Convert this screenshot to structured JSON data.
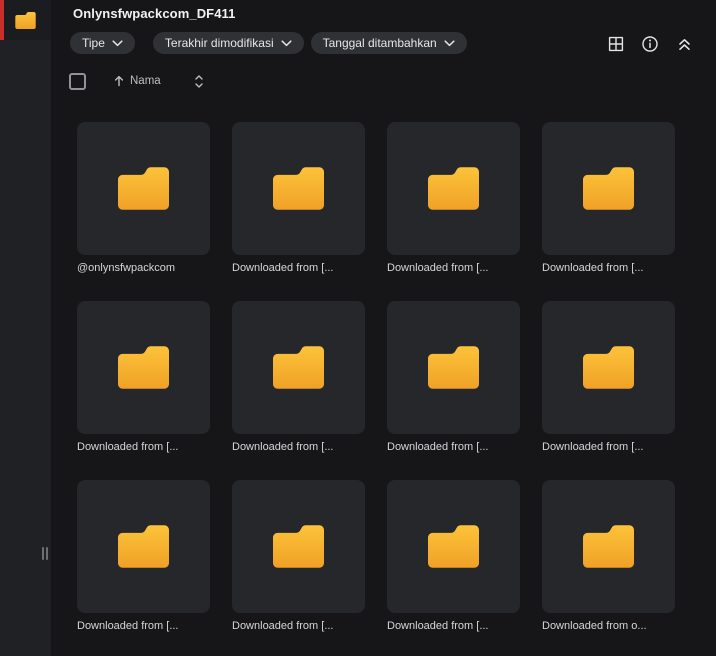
{
  "window": {
    "title": "Onlynsfwpackcom_DF411"
  },
  "colors": {
    "accent_red": "#cb2d2a",
    "folder_top": "#fcc33a",
    "folder_bottom": "#f0a127",
    "sidebar_bg": "#202124",
    "main_bg": "#161618",
    "tile_bg": "#25272a",
    "chip_bg": "#303134"
  },
  "sidebar": {
    "active_item_icon": "folder-icon"
  },
  "filters": {
    "chips": [
      {
        "label": "Tipe"
      },
      {
        "label": "Terakhir dimodifikasi"
      },
      {
        "label": "Tanggal ditambahkan"
      }
    ]
  },
  "header_actions": {
    "grid_view": "grid-view-icon",
    "info": "info-icon",
    "collapse": "double-chevron-up-icon"
  },
  "list_controls": {
    "sort_arrow": "↑",
    "sort_label": "Nama"
  },
  "folders": [
    {
      "name": "@onlynsfwpackcom"
    },
    {
      "name": "Downloaded from [..."
    },
    {
      "name": "Downloaded from [..."
    },
    {
      "name": "Downloaded from [..."
    },
    {
      "name": "Downloaded from [..."
    },
    {
      "name": "Downloaded from [..."
    },
    {
      "name": "Downloaded from [..."
    },
    {
      "name": "Downloaded from [..."
    },
    {
      "name": "Downloaded from [..."
    },
    {
      "name": "Downloaded from [..."
    },
    {
      "name": "Downloaded from [..."
    },
    {
      "name": "Downloaded from o..."
    }
  ]
}
